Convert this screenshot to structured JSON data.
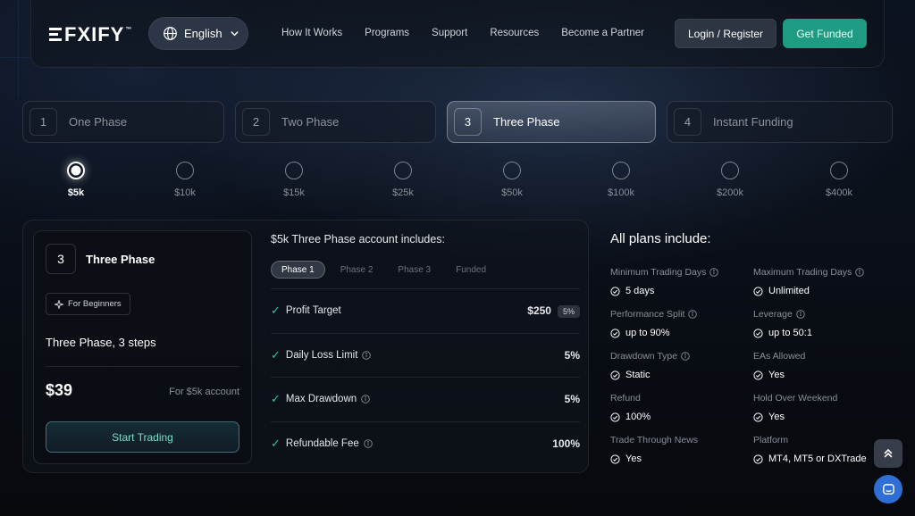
{
  "header": {
    "brand": "FXIFY",
    "brand_tm": "™",
    "language": "English",
    "nav": [
      "How It Works",
      "Programs",
      "Support",
      "Resources",
      "Become a Partner"
    ],
    "login_label": "Login / Register",
    "cta_label": "Get Funded"
  },
  "tabs": [
    {
      "num": "1",
      "label": "One Phase"
    },
    {
      "num": "2",
      "label": "Two Phase"
    },
    {
      "num": "3",
      "label": "Three Phase",
      "active": true
    },
    {
      "num": "4",
      "label": "Instant Funding"
    }
  ],
  "account_sizes": [
    "$5k",
    "$10k",
    "$15k",
    "$25k",
    "$50k",
    "$100k",
    "$200k",
    "$400k"
  ],
  "selected_size": "$5k",
  "plan": {
    "num": "3",
    "name": "Three Phase",
    "badge": "For Beginners",
    "description": "Three Phase, 3 steps",
    "price": "$39",
    "price_note": "For $5k account",
    "cta": "Start Trading"
  },
  "includes": {
    "title": "$5k Three Phase account includes:",
    "phase_tabs": [
      "Phase 1",
      "Phase 2",
      "Phase 3",
      "Funded"
    ],
    "active_phase": "Phase 1",
    "rows": [
      {
        "label": "Profit Target",
        "value": "$250",
        "pct": "5%"
      },
      {
        "label": "Daily Loss Limit",
        "value": "5%"
      },
      {
        "label": "Max Drawdown",
        "value": "5%"
      },
      {
        "label": "Refundable Fee",
        "value": "100%"
      }
    ]
  },
  "all_plans": {
    "title": "All plans include:",
    "features": [
      {
        "label": "Minimum Trading Days",
        "value": "5 days",
        "info": true
      },
      {
        "label": "Maximum Trading Days",
        "value": "Unlimited",
        "info": true
      },
      {
        "label": "Performance Split",
        "value": "up to 90%",
        "info": true
      },
      {
        "label": "Leverage",
        "value": "up to 50:1",
        "info": true
      },
      {
        "label": "Drawdown Type",
        "value": "Static",
        "info": true
      },
      {
        "label": "EAs Allowed",
        "value": "Yes",
        "info": false
      },
      {
        "label": "Refund",
        "value": "100%",
        "info": false
      },
      {
        "label": "Hold Over Weekend",
        "value": "Yes",
        "info": false
      },
      {
        "label": "Trade Through News",
        "value": "Yes",
        "info": false
      },
      {
        "label": "Platform",
        "value": "MT4, MT5 or DXTrade",
        "info": false
      }
    ]
  },
  "colors": {
    "accent": "#1f9a83",
    "check": "#2fc6a0",
    "chat": "#2f6fd4"
  },
  "icons": [
    "globe-icon",
    "chevron-down-icon",
    "sparkle-icon",
    "info-icon",
    "check-circle-icon",
    "double-chevron-up-icon",
    "chat-icon"
  ]
}
